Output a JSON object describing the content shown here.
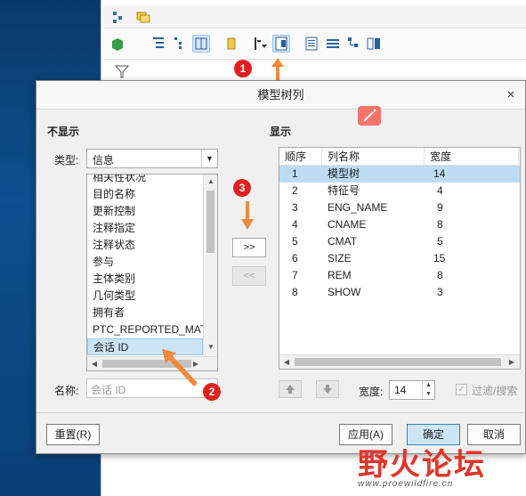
{
  "dialog": {
    "title": "模型树列",
    "close_glyph": "×",
    "hidden_section": "不显示",
    "shown_section": "显示",
    "type_label": "类型:",
    "type_value": "信息",
    "available_items": [
      "相关性状况",
      "目的名称",
      "更新控制",
      "注释指定",
      "注释状态",
      "参与",
      "主体类别",
      "几何类型",
      "拥有者",
      "PTC_REPORTED_MATE",
      "会话 ID"
    ],
    "name_label": "名称:",
    "name_placeholder": "会话 ID",
    "add_button": ">>",
    "remove_button": "<<",
    "table_headers": {
      "order": "顺序",
      "column_name": "列名称",
      "width": "宽度"
    },
    "rows": [
      {
        "order": "1",
        "name": "模型树",
        "width": "14"
      },
      {
        "order": "2",
        "name": "特征号",
        "width": "4"
      },
      {
        "order": "3",
        "name": "ENG_NAME",
        "width": "9"
      },
      {
        "order": "4",
        "name": "CNAME",
        "width": "8"
      },
      {
        "order": "5",
        "name": "CMAT",
        "width": "5"
      },
      {
        "order": "6",
        "name": "SIZE",
        "width": "15"
      },
      {
        "order": "7",
        "name": "REM",
        "width": "8"
      },
      {
        "order": "8",
        "name": "SHOW",
        "width": "3"
      }
    ],
    "width_label": "宽度:",
    "width_value": "14",
    "filter_label": "过滤/搜索",
    "reset_button": "重置(R)",
    "apply_button": "应用(A)",
    "ok_button": "确定",
    "cancel_button": "取消"
  },
  "annotations": {
    "badge1": "1",
    "badge2": "2",
    "badge3": "3"
  },
  "watermark": {
    "text": "野火论坛",
    "url": "www.proewildfire.cn"
  },
  "colors": {
    "accent": "#e02020",
    "arrow": "#f08a3c",
    "selection": "#bcdcf4"
  }
}
